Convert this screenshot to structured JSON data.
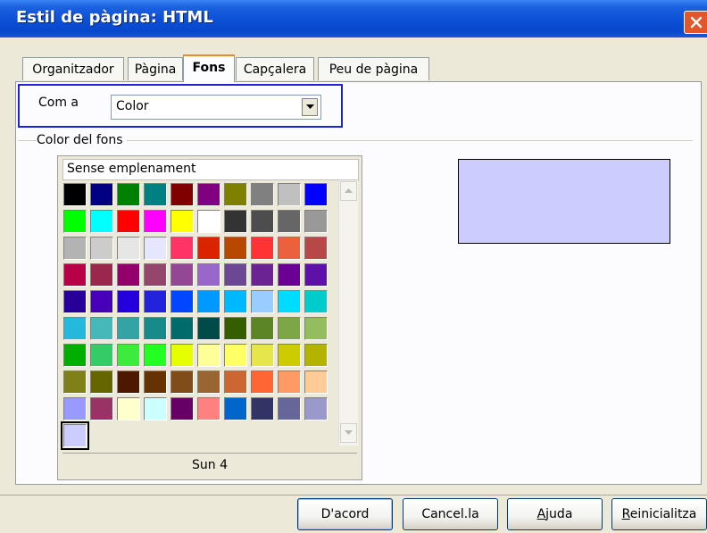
{
  "window": {
    "title": "Estil de pàgina: HTML",
    "close_icon": "close-icon"
  },
  "tabs": [
    {
      "label": "Organitzador",
      "active": false
    },
    {
      "label": "Pàgina",
      "active": false
    },
    {
      "label": "Fons",
      "active": true
    },
    {
      "label": "Capçalera",
      "active": false
    },
    {
      "label": "Peu de pàgina",
      "active": false
    }
  ],
  "as_field": {
    "label": "Com a",
    "selected": "Color"
  },
  "background_group": {
    "title": "Color del fons",
    "no_fill": "Sense emplenament",
    "palette_name": "Sun 4",
    "preview_color": "#ccccff",
    "selected_color": "#ccccff",
    "swatches": [
      "#000000",
      "#000080",
      "#008000",
      "#008080",
      "#800000",
      "#800080",
      "#808000",
      "#808080",
      "#c0c0c0",
      "#0000ff",
      "#00ff00",
      "#00ffff",
      "#ff0000",
      "#ff00ff",
      "#ffff00",
      "#ffffff",
      "#333333",
      "#4d4d4d",
      "#666666",
      "#999999",
      "#b3b3b3",
      "#cccccc",
      "#e6e6e6",
      "#e6e6ff",
      "#ff3366",
      "#dc2300",
      "#b84700",
      "#ff3333",
      "#eb613d",
      "#b84747",
      "#b80047",
      "#99284c",
      "#94006b",
      "#94476b",
      "#944794",
      "#9966cc",
      "#6b4794",
      "#6b2394",
      "#6b0094",
      "#5e11a6",
      "#280099",
      "#4700b8",
      "#2300dc",
      "#2323dc",
      "#0047ff",
      "#0099ff",
      "#00b8ff",
      "#99ccff",
      "#00dcff",
      "#00cccc",
      "#23b8dc",
      "#47b8b8",
      "#33a3a3",
      "#198a8a",
      "#006b6b",
      "#004a4a",
      "#355e00",
      "#5c8526",
      "#7da647",
      "#94bd5e",
      "#00ae00",
      "#33cc66",
      "#3deb3d",
      "#23ff23",
      "#e6ff00",
      "#ffff99",
      "#ffff66",
      "#e6e64c",
      "#cccc00",
      "#b3b300",
      "#808019",
      "#666600",
      "#4c1900",
      "#663300",
      "#804c19",
      "#996633",
      "#cc6633",
      "#ff6633",
      "#ff9966",
      "#ffcc99",
      "#9999ff",
      "#993366",
      "#ffffcc",
      "#ccffff",
      "#660066",
      "#ff8080",
      "#0066cc",
      "#333366",
      "#666699",
      "#9999cc",
      "#ccccff"
    ]
  },
  "buttons": {
    "ok": "D'acord",
    "cancel": "Cancel.la",
    "help": "Ajuda",
    "reset": "Reinicialitza"
  }
}
